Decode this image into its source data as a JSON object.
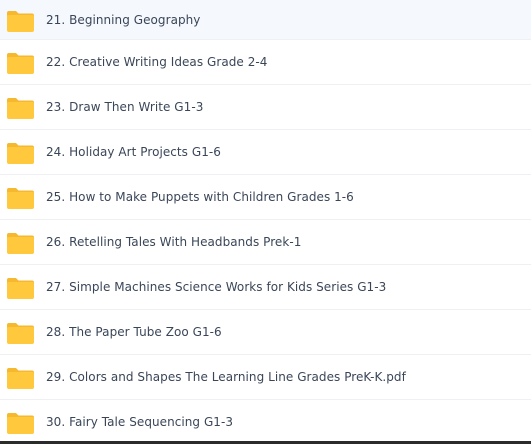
{
  "folders": [
    {
      "name": "21. Beginning Geography",
      "icon": "folder-icon",
      "selected": true
    },
    {
      "name": "22. Creative Writing Ideas Grade 2-4",
      "icon": "folder-icon",
      "selected": false
    },
    {
      "name": "23. Draw Then Write G1-3",
      "icon": "folder-icon",
      "selected": false
    },
    {
      "name": "24. Holiday Art Projects G1-6",
      "icon": "folder-icon",
      "selected": false
    },
    {
      "name": "25. How to Make Puppets with Children Grades 1-6",
      "icon": "folder-icon",
      "selected": false
    },
    {
      "name": "26. Retelling Tales With Headbands Prek-1",
      "icon": "folder-icon",
      "selected": false
    },
    {
      "name": "27. Simple Machines Science Works for Kids Series G1-3",
      "icon": "folder-icon",
      "selected": false
    },
    {
      "name": "28. The Paper Tube Zoo G1-6",
      "icon": "folder-icon",
      "selected": false
    },
    {
      "name": "29. Colors and Shapes The Learning Line Grades PreK-K.pdf",
      "icon": "folder-icon",
      "selected": false
    },
    {
      "name": "30. Fairy Tale Sequencing G1-3",
      "icon": "folder-icon",
      "selected": false
    }
  ],
  "colors": {
    "folder_body": "#ffc83d",
    "folder_back": "#f5b82e",
    "text": "#3a4658",
    "selected_row": "#f3f6fa"
  }
}
